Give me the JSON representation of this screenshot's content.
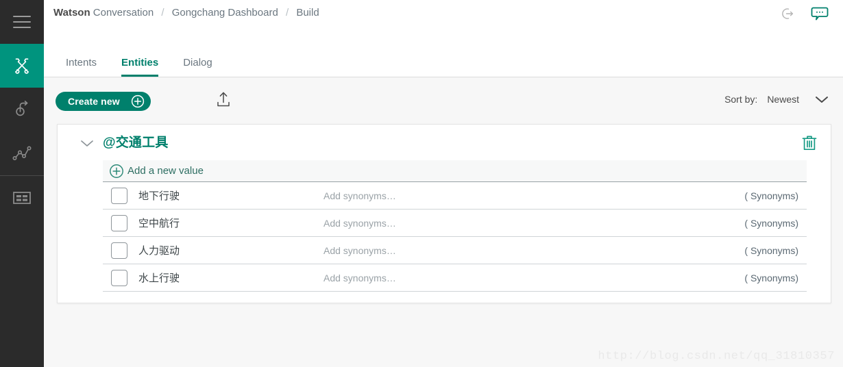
{
  "colors": {
    "accent_teal": "#00806c",
    "rail_active": "#00947e",
    "rail_bg": "#2b2b2b",
    "page_bg": "#f7f7f7",
    "card_bg": "#ffffff",
    "text_muted": "#6b7780"
  },
  "rail": {
    "items": [
      {
        "name": "menu-icon",
        "label": "Menu",
        "active": false
      },
      {
        "name": "tools-icon",
        "label": "Build",
        "active": true
      },
      {
        "name": "deploy-icon",
        "label": "Deploy",
        "active": false
      },
      {
        "name": "analytics-icon",
        "label": "Improve",
        "active": false
      },
      {
        "name": "content-catalog-icon",
        "label": "Content Catalog",
        "active": false
      }
    ]
  },
  "topbar": {
    "breadcrumb": {
      "brand_bold": "Watson",
      "brand_regular": "Conversation",
      "separator": "/",
      "crumbs": [
        "Gongchang Dashboard",
        "Build"
      ]
    },
    "actions": [
      {
        "name": "logout-icon",
        "label": "Log out"
      },
      {
        "name": "chat-bubble-icon",
        "label": "Try it out"
      }
    ]
  },
  "tabs": [
    {
      "label": "Intents",
      "active": false
    },
    {
      "label": "Entities",
      "active": true
    },
    {
      "label": "Dialog",
      "active": false
    }
  ],
  "toolbar": {
    "create_label": "Create new",
    "create_icon": "plus-circle-icon",
    "upload_icon": "upload-icon",
    "sort_label": "Sort by:",
    "sort_value": "Newest",
    "sort_chevron": "chevron-down-icon"
  },
  "entity": {
    "collapse_icon": "chevron-down-icon",
    "name": "@交通工具",
    "delete_icon": "trash-icon",
    "add_value_label": "Add a new value",
    "add_value_icon": "plus-circle-icon",
    "values": [
      {
        "name": "地下行驶",
        "synonyms_placeholder": "Add synonyms…",
        "synonyms_count": "( Synonyms)"
      },
      {
        "name": "空中航行",
        "synonyms_placeholder": "Add synonyms…",
        "synonyms_count": "( Synonyms)"
      },
      {
        "name": "人力驱动",
        "synonyms_placeholder": "Add synonyms…",
        "synonyms_count": "( Synonyms)"
      },
      {
        "name": "水上行驶",
        "synonyms_placeholder": "Add synonyms…",
        "synonyms_count": "( Synonyms)"
      }
    ]
  },
  "watermark": "http://blog.csdn.net/qq_31810357"
}
